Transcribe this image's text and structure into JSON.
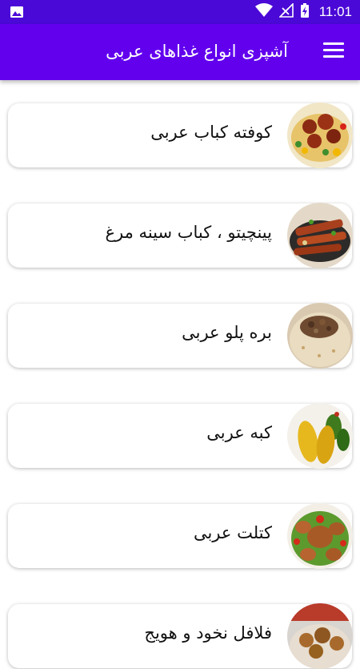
{
  "status_bar": {
    "time": "11:01",
    "icons": [
      "image-notification-icon",
      "wifi-icon",
      "signal-icon",
      "battery-charging-icon"
    ]
  },
  "app_bar": {
    "title": "آشپزی انواع غذاهای عربی",
    "menu_icon": "hamburger-menu-icon"
  },
  "recipes": [
    {
      "label": "کوفته کباب عربی",
      "image": "meatballs-vegetables-photo"
    },
    {
      "label": "پینچیتو ، کباب سینه مرغ",
      "image": "chicken-kebab-skewers-photo"
    },
    {
      "label": "بره پلو عربی",
      "image": "lamb-rice-photo"
    },
    {
      "label": "کبه عربی",
      "image": "kibbeh-photo"
    },
    {
      "label": "کتلت عربی",
      "image": "cutlet-photo"
    },
    {
      "label": "فلافل نخود و هویج",
      "image": "falafel-photo"
    }
  ],
  "colors": {
    "status_bar": "#4a09d6",
    "app_bar": "#6200ee",
    "background": "#ffffff"
  }
}
